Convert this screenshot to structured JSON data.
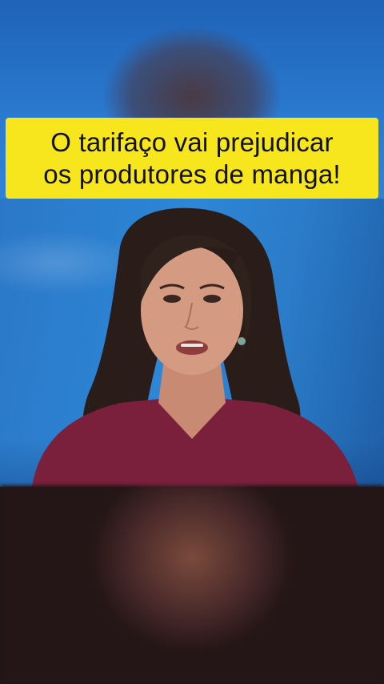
{
  "caption": {
    "line1": "O tarifaço vai prejudicar",
    "line2": "os produtores de manga!"
  },
  "colors": {
    "caption_bg": "#f7e51d",
    "caption_text": "#111111",
    "studio_blue": "#2b7cc9"
  },
  "icons": {
    "presenter": "news-anchor-figure"
  }
}
